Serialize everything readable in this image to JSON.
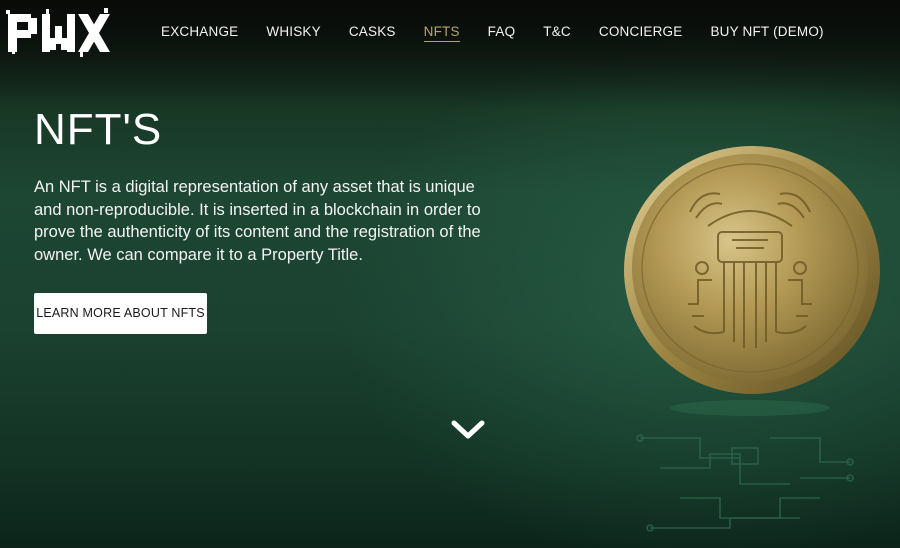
{
  "brand": {
    "logo_text": "PWX"
  },
  "nav": {
    "items": [
      {
        "label": "EXCHANGE",
        "active": false
      },
      {
        "label": "WHISKY",
        "active": false
      },
      {
        "label": "CASKS",
        "active": false
      },
      {
        "label": "NFTS",
        "active": true
      },
      {
        "label": "FAQ",
        "active": false
      },
      {
        "label": "T&C",
        "active": false
      },
      {
        "label": "CONCIERGE",
        "active": false
      },
      {
        "label": "BUY NFT (DEMO)",
        "active": false
      }
    ],
    "active_color": "#b8a56a"
  },
  "hero": {
    "title": "NFT'S",
    "description": "An NFT is a digital representation of any asset that is unique and non-reproducible. It is inserted in a blockchain in order to prove the authenticity of its content and the registration of the owner. We can compare it to a Property Title.",
    "cta_label": "LEARN MORE ABOUT NFTS",
    "scroll_icon": "chevron-down-icon",
    "coin_image": "gold-nft-coin",
    "background_color": "#1d4633"
  }
}
